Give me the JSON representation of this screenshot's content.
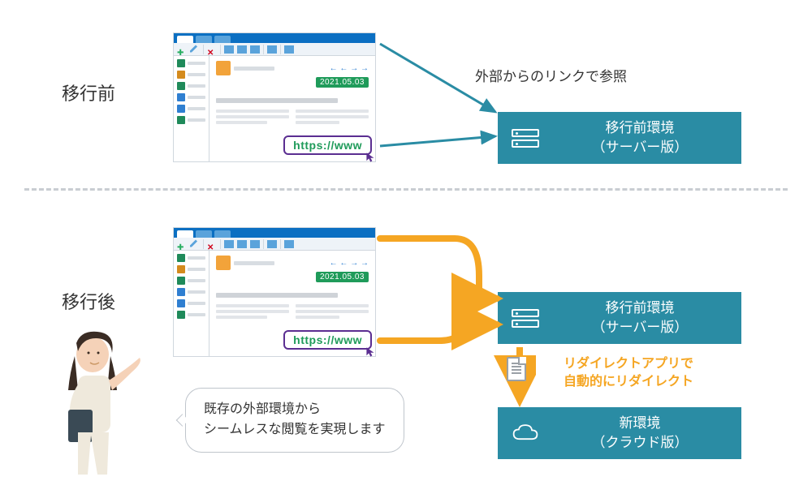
{
  "sections": {
    "before": {
      "label": "移行前"
    },
    "after": {
      "label": "移行後"
    }
  },
  "app_mock": {
    "date_badge": "2021.05.03",
    "url": "https://www"
  },
  "external_link_note": "外部からのリンクで参照",
  "env": {
    "before": {
      "line1": "移行前環境",
      "line2": "（サーバー版）"
    },
    "after_old": {
      "line1": "移行前環境",
      "line2": "（サーバー版）"
    },
    "after_new": {
      "line1": "新環境",
      "line2": "（クラウド版）"
    }
  },
  "redirect_note": {
    "line1": "リダイレクトアプリで",
    "line2": "自動的にリダイレクト"
  },
  "speech": {
    "line1": "既存の外部環境から",
    "line2": "シームレスな閲覧を実現します"
  },
  "colors": {
    "teal": "#2a8ca4",
    "orange": "#f5a623",
    "green": "#1f9b5a",
    "blue_arrow": "#2a8ca4"
  }
}
